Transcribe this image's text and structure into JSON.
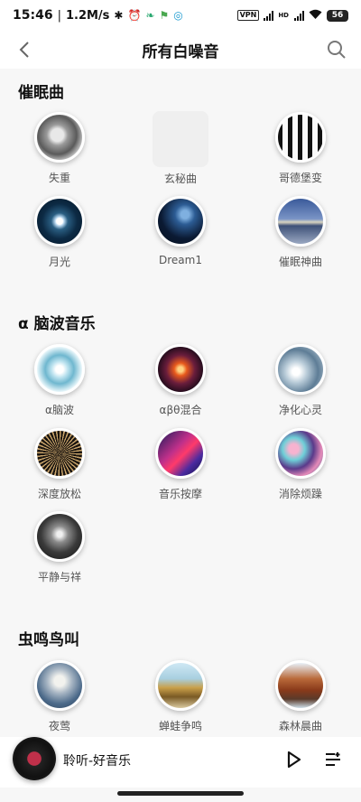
{
  "status_bar": {
    "time": "15:46",
    "speed": "1.2M/s",
    "vpn": "VPN",
    "hd": "HD",
    "battery": "56"
  },
  "header": {
    "title": "所有白噪音",
    "back_icon": "chevron-left-icon",
    "search_icon": "search-icon"
  },
  "sections": [
    {
      "title": "催眠曲",
      "items": [
        {
          "label": "失重",
          "thumb": "t-shizhong"
        },
        {
          "label": "玄秘曲",
          "thumb": "blank"
        },
        {
          "label": "哥德堡变",
          "thumb": "t-gedebao"
        },
        {
          "label": "月光",
          "thumb": "t-yueguang"
        },
        {
          "label": "Dream1",
          "thumb": "t-dream"
        },
        {
          "label": "催眠神曲",
          "thumb": "t-cuimian"
        }
      ]
    },
    {
      "title": "α 脑波音乐",
      "items": [
        {
          "label": "α脑波",
          "thumb": "t-anao"
        },
        {
          "label": "αβθ混合",
          "thumb": "t-abt"
        },
        {
          "label": "净化心灵",
          "thumb": "t-jinghua"
        },
        {
          "label": "深度放松",
          "thumb": "t-shendu"
        },
        {
          "label": "音乐按摩",
          "thumb": "t-anmo"
        },
        {
          "label": "消除烦躁",
          "thumb": "t-fanzao"
        },
        {
          "label": "平静与祥",
          "thumb": "t-pingjing"
        }
      ]
    },
    {
      "title": "虫鸣鸟叫",
      "items": [
        {
          "label": "夜莺",
          "thumb": "t-yeying"
        },
        {
          "label": "蝉蛙争鸣",
          "thumb": "t-wa"
        },
        {
          "label": "森林晨曲",
          "thumb": "t-senlin"
        }
      ]
    }
  ],
  "player": {
    "title": "聆听-好音乐",
    "play_icon": "play-icon",
    "playlist_icon": "playlist-icon"
  },
  "colors": {
    "background": "#f7f7f7",
    "surface": "#ffffff",
    "text_primary": "#111111",
    "text_secondary": "#555555",
    "disc_center": "#c0304a"
  }
}
